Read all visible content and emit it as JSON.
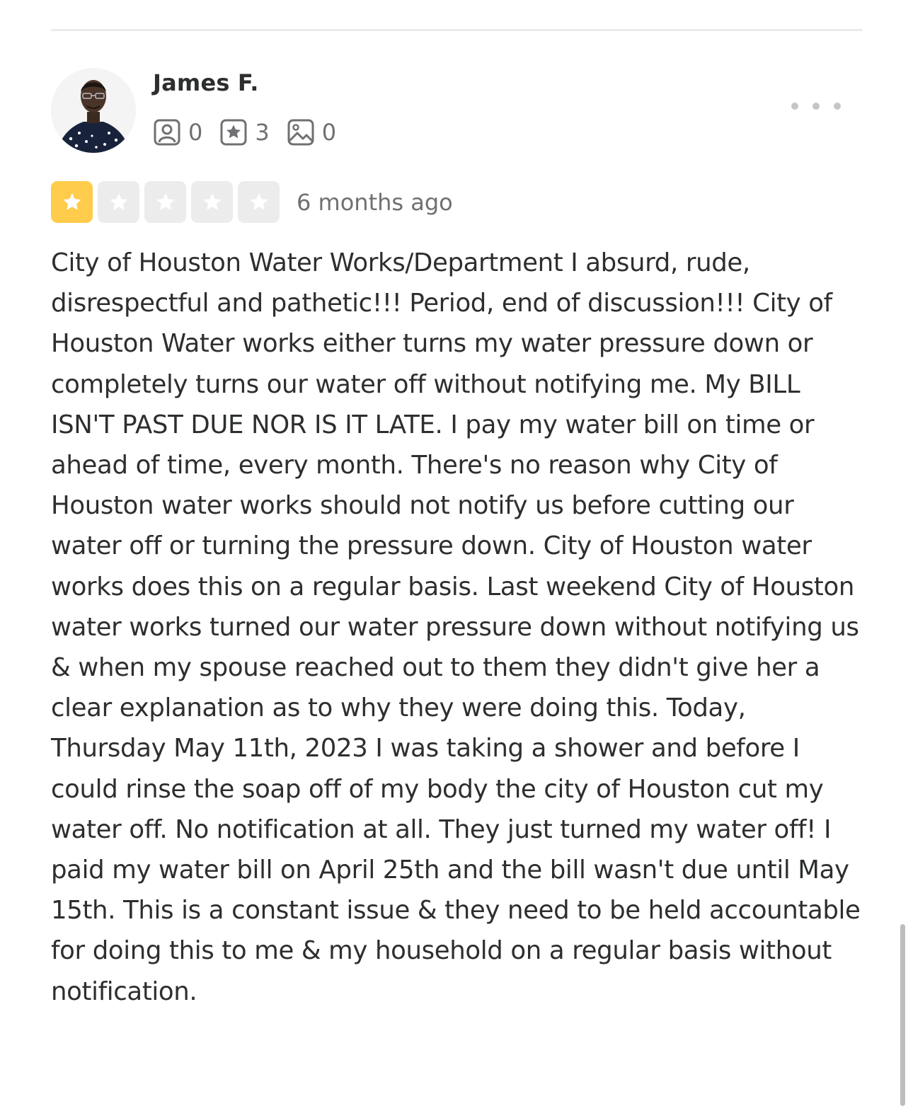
{
  "reviewer": {
    "name": "James F.",
    "stats": {
      "friends": "0",
      "reviews": "3",
      "photos": "0"
    }
  },
  "review": {
    "rating": 1,
    "max_rating": 5,
    "time_ago": "6 months ago",
    "text": "City of Houston Water Works/Department I absurd, rude, disrespectful and pathetic!!! Period, end of discussion!!! City of Houston Water works either turns my water pressure down or completely turns our water off without notifying me. My BILL ISN'T PAST DUE NOR IS IT LATE. I pay my water bill on time or ahead of time, every month. There's no reason why City of Houston water works should not notify us before cutting our water off or turning the pressure down. City of Houston water works does this on a regular basis. Last weekend City of Houston water works turned our water pressure down without notifying us & when my spouse reached out to them they didn't give her a clear explanation as to why they were doing this. Today, Thursday May 11th, 2023 I was taking a shower and before I could rinse the soap off of my body the city of Houston cut my water off. No notification at all. They just turned my water off! I paid my water bill on April 25th and the bill wasn't due until May 15th. This is a constant issue & they need to be held accountable for doing this to me & my household on a regular basis without notification."
  },
  "icons": {
    "friends": "friends-icon",
    "reviews": "review-star-icon",
    "photos": "photo-icon",
    "more": "more-options-icon"
  },
  "colors": {
    "star_filled": "#ffcc4b",
    "star_empty": "#ececec",
    "text": "#2d2e2f",
    "muted": "#6e7072"
  }
}
